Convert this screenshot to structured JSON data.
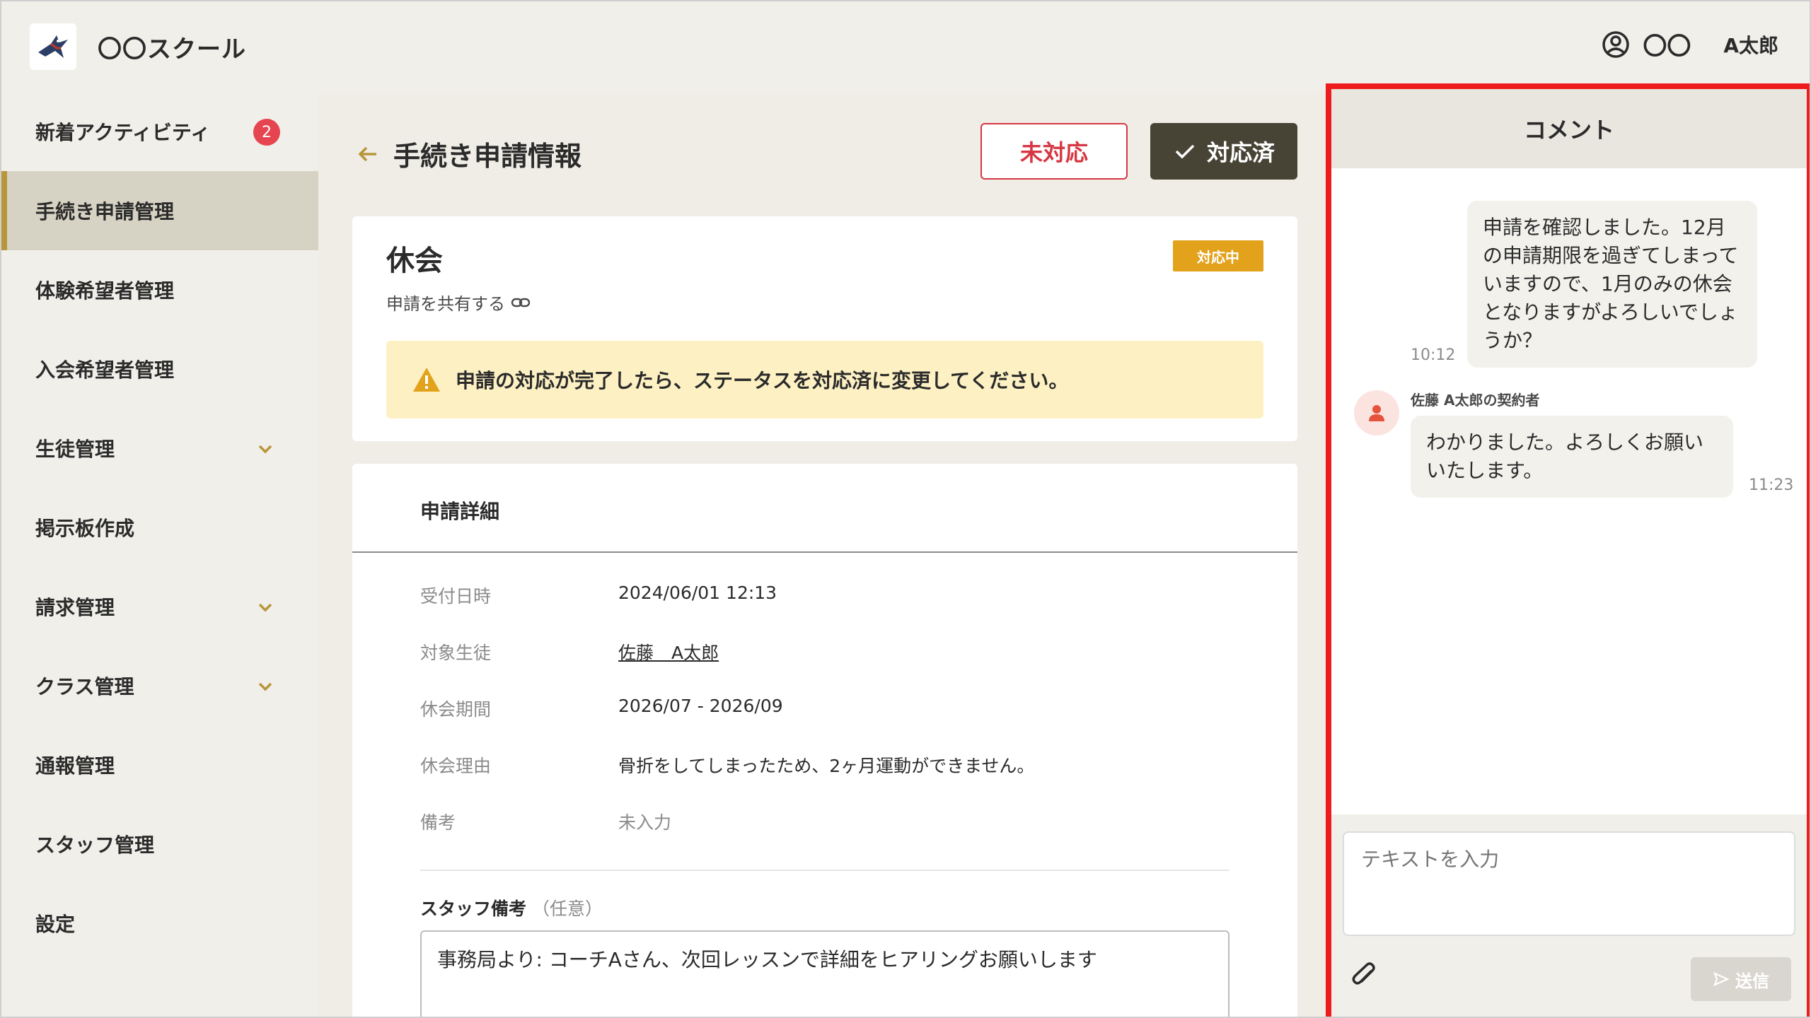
{
  "header": {
    "app_title": "〇〇スクール",
    "user_prefix": "〇〇",
    "user_name": "A太郎"
  },
  "sidebar": {
    "items": [
      {
        "label": "新着アクティビティ",
        "badge": "2"
      },
      {
        "label": "手続き申請管理",
        "active": true
      },
      {
        "label": "体験希望者管理"
      },
      {
        "label": "入会希望者管理"
      },
      {
        "label": "生徒管理",
        "expandable": true
      },
      {
        "label": "掲示板作成"
      },
      {
        "label": "請求管理",
        "expandable": true
      },
      {
        "label": "クラス管理",
        "expandable": true
      },
      {
        "label": "通報管理"
      },
      {
        "label": "スタッフ管理"
      },
      {
        "label": "設定"
      }
    ]
  },
  "main": {
    "page_title": "手続き申請情報",
    "btn_unhandled": "未対応",
    "btn_done": "対応済",
    "request_type": "休会",
    "status": "対応中",
    "share_text": "申請を共有する",
    "alert": "申請の対応が完了したら、ステータスを対応済に変更してください。",
    "detail_title": "申請詳細",
    "details": [
      {
        "label": "受付日時",
        "value": "2024/06/01 12:13"
      },
      {
        "label": "対象生徒",
        "value": "佐藤　A太郎"
      },
      {
        "label": "休会期間",
        "value": "2026/07 - 2026/09"
      },
      {
        "label": "休会理由",
        "value": "骨折をしてしまったため、2ヶ月運動ができません。"
      },
      {
        "label": "備考",
        "value": "未入力"
      }
    ],
    "staff_note_label": "スタッフ備考",
    "staff_note_optional": "（任意）",
    "staff_note_value": "事務局より: コーチAさん、次回レッスンで詳細をヒアリングお願いします"
  },
  "comments": {
    "title": "コメント",
    "messages": [
      {
        "text": "申請を確認しました。12月の申請期限を過ぎてしまっていますので、1月のみの休会となりますがよろしいでしょうか？",
        "time": "10:12"
      },
      {
        "sender": "佐藤 A太郎の契約者",
        "text": "わかりました。よろしくお願いいたします。",
        "time": "11:23"
      }
    ],
    "input_placeholder": "テキストを入力",
    "send_label": "送信"
  },
  "colors": {
    "accent": "#b8963a",
    "danger": "#d63743",
    "status": "#e2a21c",
    "dark_button": "#474335",
    "alert_bg": "#fdf1c4",
    "highlight_border": "#ee1c1c"
  }
}
